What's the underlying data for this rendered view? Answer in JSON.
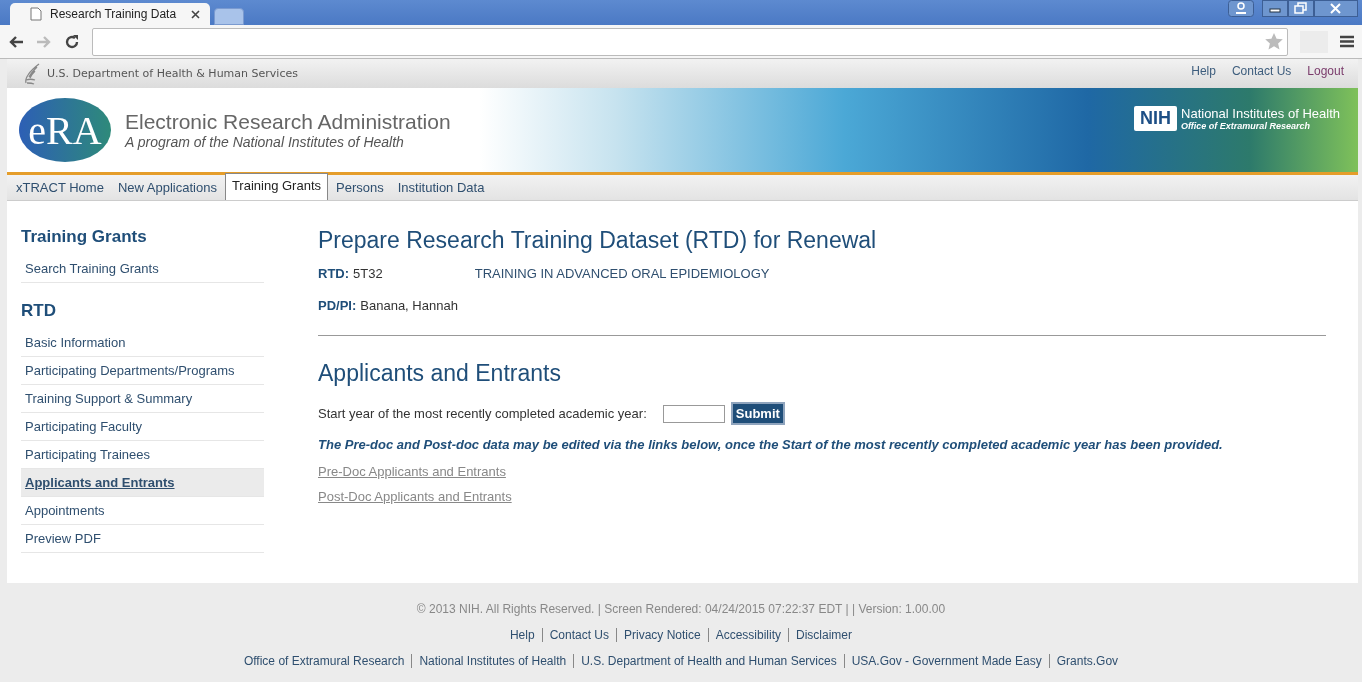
{
  "browser": {
    "tabs": [
      {
        "title": "Research Training Data",
        "selected": true
      },
      {
        "selected": false
      }
    ]
  },
  "top_bar": {
    "agency": "U.S. Department of Health & Human Services",
    "links": [
      {
        "label": "Help",
        "kind": "plain"
      },
      {
        "label": "Contact Us",
        "kind": "plain"
      },
      {
        "label": "Logout",
        "kind": "visited"
      }
    ]
  },
  "banner": {
    "logo_text": "eRA",
    "title": "Electronic Research Administration",
    "subtitle": "A program of the National Institutes of Health",
    "nih_logo": "NIH",
    "nih_name": "National Institutes of Health",
    "nih_office": "Office of  Extramural Research"
  },
  "nav_tabs": [
    {
      "label": "xTRACT Home",
      "selected": false
    },
    {
      "label": "New Applications",
      "selected": false
    },
    {
      "label": "Training Grants",
      "selected": true
    },
    {
      "label": "Persons",
      "selected": false
    },
    {
      "label": "Institution Data",
      "selected": false
    }
  ],
  "sidebar": {
    "sections": [
      {
        "heading": "Training Grants",
        "items": [
          {
            "label": "Search Training Grants",
            "selected": false
          }
        ]
      },
      {
        "heading": "RTD",
        "items": [
          {
            "label": "Basic Information",
            "selected": false
          },
          {
            "label": "Participating Departments/Programs",
            "selected": false
          },
          {
            "label": "Training Support & Summary",
            "selected": false
          },
          {
            "label": "Participating Faculty",
            "selected": false
          },
          {
            "label": "Participating Trainees",
            "selected": false
          },
          {
            "label": "Applicants and Entrants",
            "selected": true
          },
          {
            "label": "Appointments",
            "selected": false
          },
          {
            "label": "Preview PDF",
            "selected": false
          }
        ]
      }
    ]
  },
  "main": {
    "title": "Prepare Research Training Dataset (RTD) for Renewal",
    "fields": [
      {
        "label": "RTD:",
        "value": "5T32",
        "extra": "TRAINING IN ADVANCED ORAL EPIDEMIOLOGY"
      },
      {
        "label": "PD/PI:",
        "value": "Banana, Hannah"
      }
    ],
    "section_title": "Applicants and Entrants",
    "year_label": "Start year of the most recently completed academic year:",
    "submit": "Submit",
    "note": "The Pre-doc and Post-doc data may be edited via the links below, once the Start of the most recently completed academic year has been provided.",
    "links": [
      "Pre-Doc Applicants and Entrants",
      "Post-Doc Applicants and Entrants"
    ]
  },
  "footer": {
    "copyright": "© 2013 NIH. All Rights Reserved. | Screen Rendered: 04/24/2015 07:22:37 EDT | | Version: 1.00.00",
    "links_1": [
      "Help",
      "Contact Us",
      "Privacy Notice",
      "Accessibility",
      "Disclaimer"
    ],
    "links_2": [
      "Office of Extramural Research",
      "National Institutes of Health",
      "U.S. Department of Health and Human Services",
      "USA.Gov - Government Made Easy",
      "Grants.Gov"
    ]
  }
}
